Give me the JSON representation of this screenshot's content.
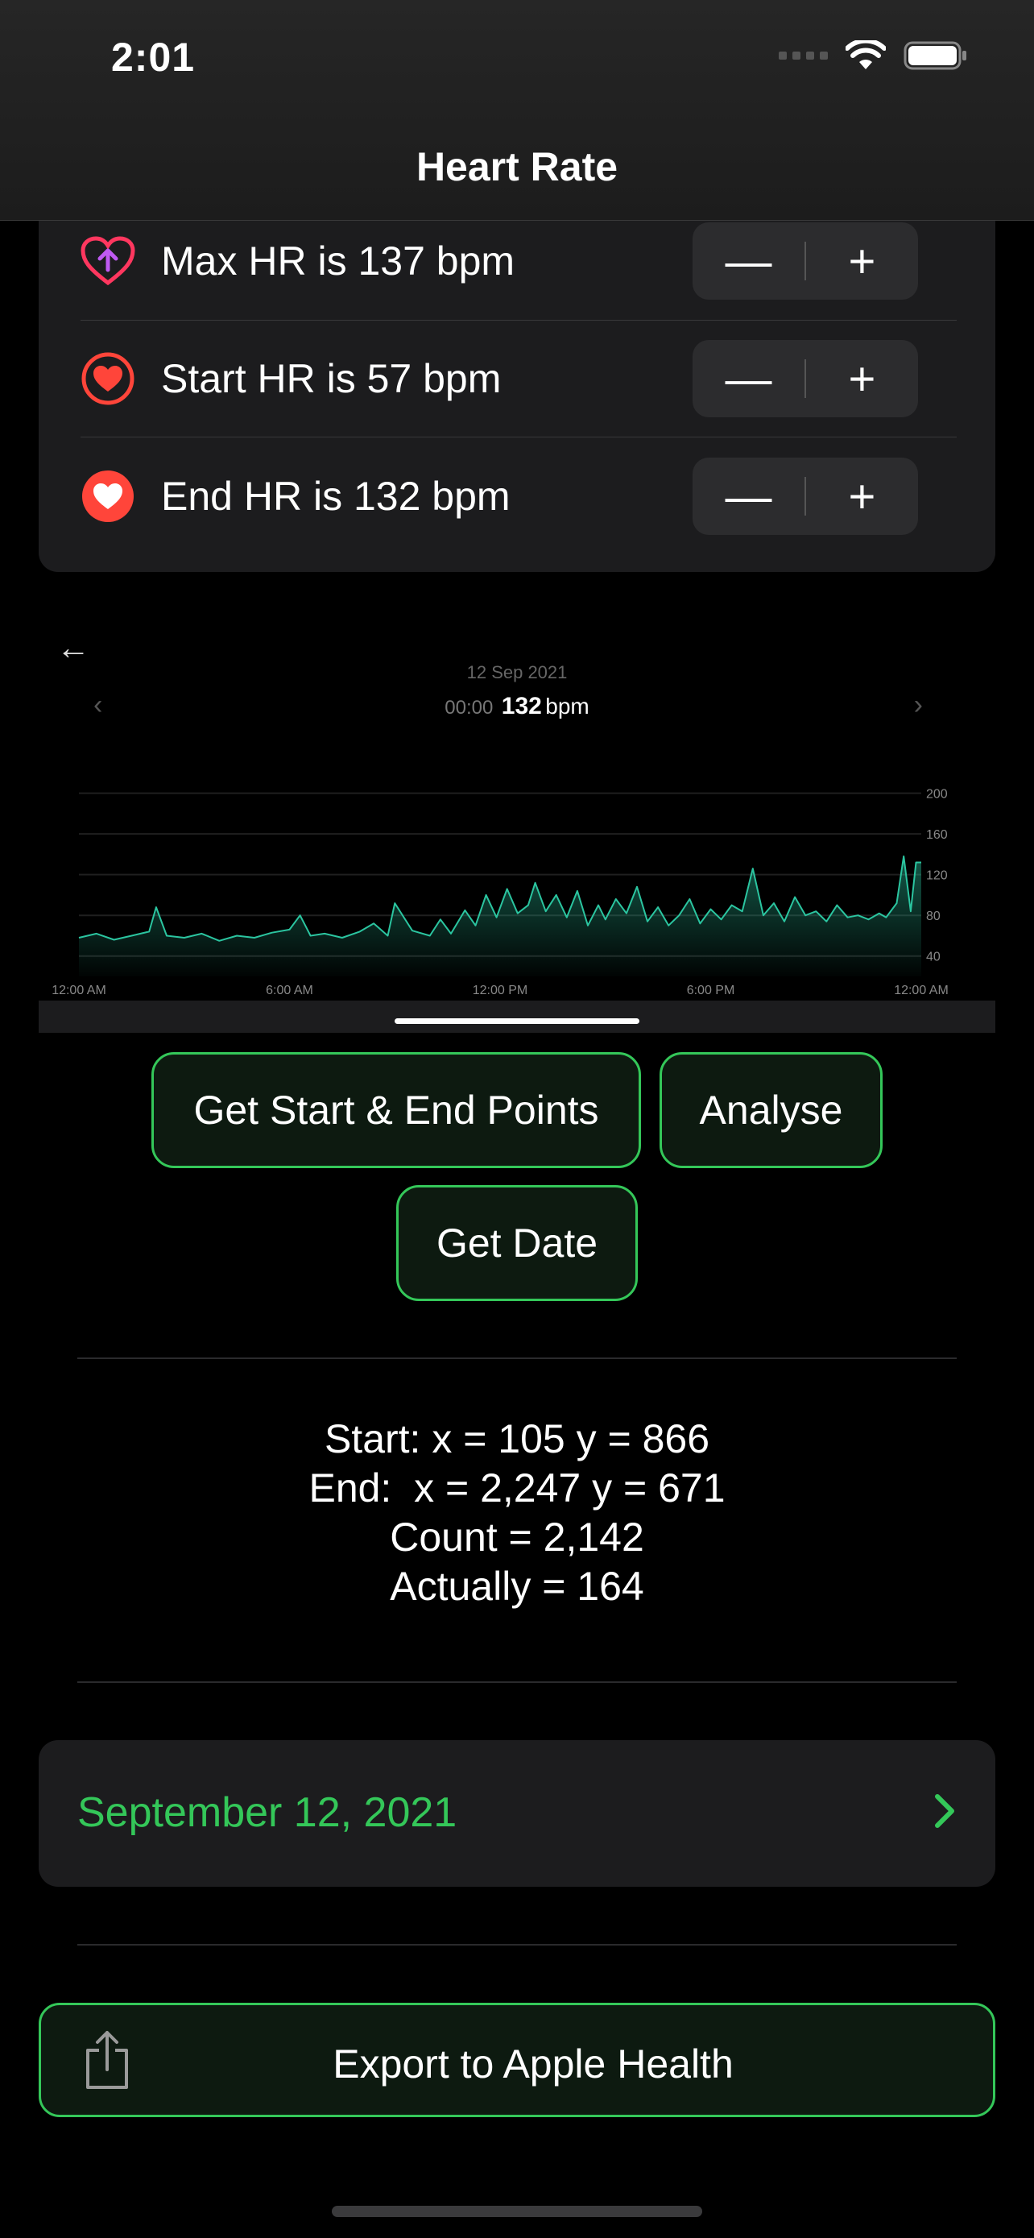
{
  "status_bar": {
    "time": "2:01"
  },
  "nav": {
    "title": "Heart Rate"
  },
  "hr_rows": [
    {
      "label": "Max HR is 137 bpm",
      "icon": "heart-arrow-up-icon"
    },
    {
      "label": "Start HR is 57 bpm",
      "icon": "heart-circle-outline-icon"
    },
    {
      "label": "End HR is 132 bpm",
      "icon": "heart-circle-filled-icon"
    }
  ],
  "stepper": {
    "minus": "—",
    "plus": "+"
  },
  "chart": {
    "back": "←",
    "date": "12 Sep 2021",
    "reading_time": "00:00",
    "reading_value": "132",
    "reading_unit": "bpm",
    "prev": "‹",
    "next": "›"
  },
  "chart_data": {
    "type": "area",
    "x_tick_labels": [
      "12:00 AM",
      "6:00 AM",
      "12:00 PM",
      "6:00 PM",
      "12:00 AM"
    ],
    "y_ticks": [
      200,
      160,
      120,
      80,
      40
    ],
    "ylim": [
      20,
      210
    ],
    "xlim": [
      0,
      24
    ],
    "color": "#2bc5a0",
    "series": [
      {
        "x": [
          0,
          0.5,
          1,
          1.5,
          2,
          2.2,
          2.5,
          3,
          3.5,
          4,
          4.5,
          5,
          5.5,
          6,
          6.3,
          6.6,
          7,
          7.5,
          8,
          8.4,
          8.8,
          9,
          9.5,
          10,
          10.3,
          10.6,
          11,
          11.3,
          11.6,
          11.9,
          12.2,
          12.5,
          12.8,
          13,
          13.3,
          13.6,
          13.9,
          14.2,
          14.5,
          14.8,
          15,
          15.3,
          15.6,
          15.9,
          16.2,
          16.5,
          16.8,
          17.1,
          17.4,
          17.7,
          18,
          18.3,
          18.6,
          18.9,
          19.2,
          19.5,
          19.8,
          20.1,
          20.4,
          20.7,
          21,
          21.3,
          21.6,
          21.9,
          22.2,
          22.5,
          22.8,
          23,
          23.3,
          23.5,
          23.7,
          23.85,
          24
        ],
        "values": [
          58,
          62,
          56,
          60,
          64,
          88,
          60,
          58,
          62,
          55,
          60,
          58,
          63,
          66,
          80,
          60,
          62,
          58,
          64,
          72,
          60,
          92,
          65,
          60,
          76,
          62,
          85,
          70,
          100,
          78,
          106,
          82,
          90,
          112,
          84,
          100,
          78,
          104,
          70,
          90,
          76,
          96,
          82,
          108,
          74,
          88,
          70,
          80,
          96,
          72,
          86,
          76,
          90,
          84,
          126,
          80,
          92,
          74,
          98,
          80,
          84,
          74,
          90,
          78,
          80,
          76,
          82,
          78,
          92,
          138,
          84,
          132,
          132
        ]
      }
    ]
  },
  "buttons": {
    "get_points": "Get Start & End Points",
    "analyse": "Analyse",
    "get_date": "Get Date"
  },
  "results": {
    "start": "Start: x = 105 y = 866",
    "end": "End:  x = 2,247 y = 671",
    "count": "Count = 2,142",
    "actually": "Actually = 164"
  },
  "date_picker": {
    "value": "September 12, 2021"
  },
  "export": {
    "label": "Export to Apple Health",
    "icon": "share-icon"
  },
  "colors": {
    "accent": "#34c759",
    "chart_line": "#2bc5a0",
    "heart": "#ff453a",
    "arrow": "#bf5af2"
  }
}
